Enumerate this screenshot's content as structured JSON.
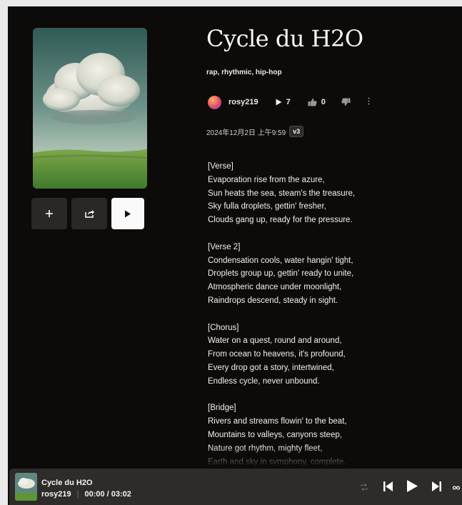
{
  "song": {
    "title": "Cycle du H2O",
    "tags": "rap, rhythmic, hip-hop",
    "artist": "rosy219",
    "plays": "7",
    "likes": "0",
    "date": "2024年12月2日 上午9:59",
    "version": "v3"
  },
  "lyrics": [
    "[Verse]",
    "Evaporation rise from the azure,",
    "Sun heats the sea, steam's the treasure,",
    "Sky fulla droplets, gettin' fresher,",
    "Clouds gang up, ready for the pressure.",
    "",
    "[Verse 2]",
    "Condensation cools, water hangin' tight,",
    "Droplets group up, gettin' ready to unite,",
    "Atmospheric dance under moonlight,",
    "Raindrops descend, steady in sight.",
    "",
    "[Chorus]",
    "Water on a quest, round and around,",
    "From ocean to heavens, it's profound,",
    "Every drop got a story, intertwined,",
    "Endless cycle, never unbound.",
    "",
    "[Bridge]",
    "Rivers and streams flowin' to the beat,",
    "Mountains to valleys, canyons steep,",
    "Nature got rhythm, mighty fleet,",
    "Earth and sky in symphony, complete."
  ],
  "player": {
    "title": "Cycle du H2O",
    "artist": "rosy219",
    "time": "00:00 / 03:02"
  },
  "icons": {
    "add": "plus-icon",
    "share": "share-icon",
    "play": "play-icon",
    "like": "thumbs-up-icon",
    "dislike": "thumbs-down-icon",
    "more": "more-vertical-icon",
    "prev": "skip-previous-icon",
    "next": "skip-next-icon",
    "repeat": "repeat-icon",
    "loop": "loop-icon"
  },
  "colors": {
    "background": "#0d0b0a",
    "player_bar": "#2e2b2a",
    "button": "#2a2827",
    "play_button": "#fafafa"
  }
}
